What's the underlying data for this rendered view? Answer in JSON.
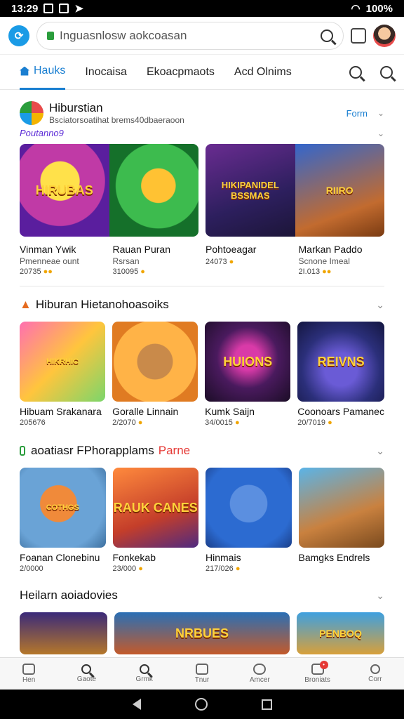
{
  "status": {
    "time": "13:29",
    "battery": "100%"
  },
  "browser": {
    "url_text": "Inguasnlosw aokcoasan"
  },
  "tabs": [
    {
      "label": "Hauks"
    },
    {
      "label": "Inocaisa"
    },
    {
      "label": "Ekoacpmaots"
    },
    {
      "label": "Acd Olnims"
    }
  ],
  "featured": {
    "title": "Hiburstian",
    "subtitle": "Bsciatorsoatihat brems40dbaeraoon",
    "tag": "Poutanno9",
    "action": "Form",
    "cards": [
      {
        "title": "Vinman Ywik",
        "sub": "Pmenneae ount",
        "meta": "20735",
        "art": "HIRUBAS"
      },
      {
        "title": "Rauan Puran",
        "sub": "Rsrsan",
        "meta": "310095",
        "art": ""
      },
      {
        "title": "Pohtoeagar",
        "sub": "",
        "meta": "24073",
        "art": "HIKIPANIDEL BSSMAS"
      },
      {
        "title": "Markan Paddo",
        "sub": "Scnone Imeal",
        "meta": "2I.013",
        "art": "RIIRO"
      }
    ]
  },
  "section2": {
    "title": "Hiburan Hietanohoasoiks",
    "cards": [
      {
        "title": "Hibuam Srakanara",
        "meta": "205676",
        "art": "HIKRHIC"
      },
      {
        "title": "Goralle Linnain",
        "meta": "2/2070",
        "art": ""
      },
      {
        "title": "Kumk Saijn",
        "meta": "34/0015",
        "art": "HUIONS"
      },
      {
        "title": "Coonoars Pamanec",
        "meta": "20/7019",
        "art": "REIVNS"
      }
    ]
  },
  "section3": {
    "title": "aoatiasr FPhorapplams",
    "highlight": "Parne",
    "cards": [
      {
        "title": "Foanan Clonebinu",
        "meta": "2/0000",
        "art": "COTHGS"
      },
      {
        "title": "Fonkekab",
        "meta": "23/000",
        "art": "RAUK CANES"
      },
      {
        "title": "Hinmais",
        "meta": "217/026",
        "art": ""
      },
      {
        "title": "Bamgks Endrels",
        "meta": "",
        "art": ""
      }
    ]
  },
  "section4": {
    "title": "Heilarn aoiadovies",
    "cards": [
      {
        "art": ""
      },
      {
        "art": "NRBUES"
      },
      {
        "art": "PENBOQ"
      }
    ]
  },
  "bottom_nav": [
    {
      "label": "Hen"
    },
    {
      "label": "Gaote"
    },
    {
      "label": "Grmk"
    },
    {
      "label": "Tnur"
    },
    {
      "label": "Amcer"
    },
    {
      "label": "Broniats"
    },
    {
      "label": "Corr"
    }
  ]
}
